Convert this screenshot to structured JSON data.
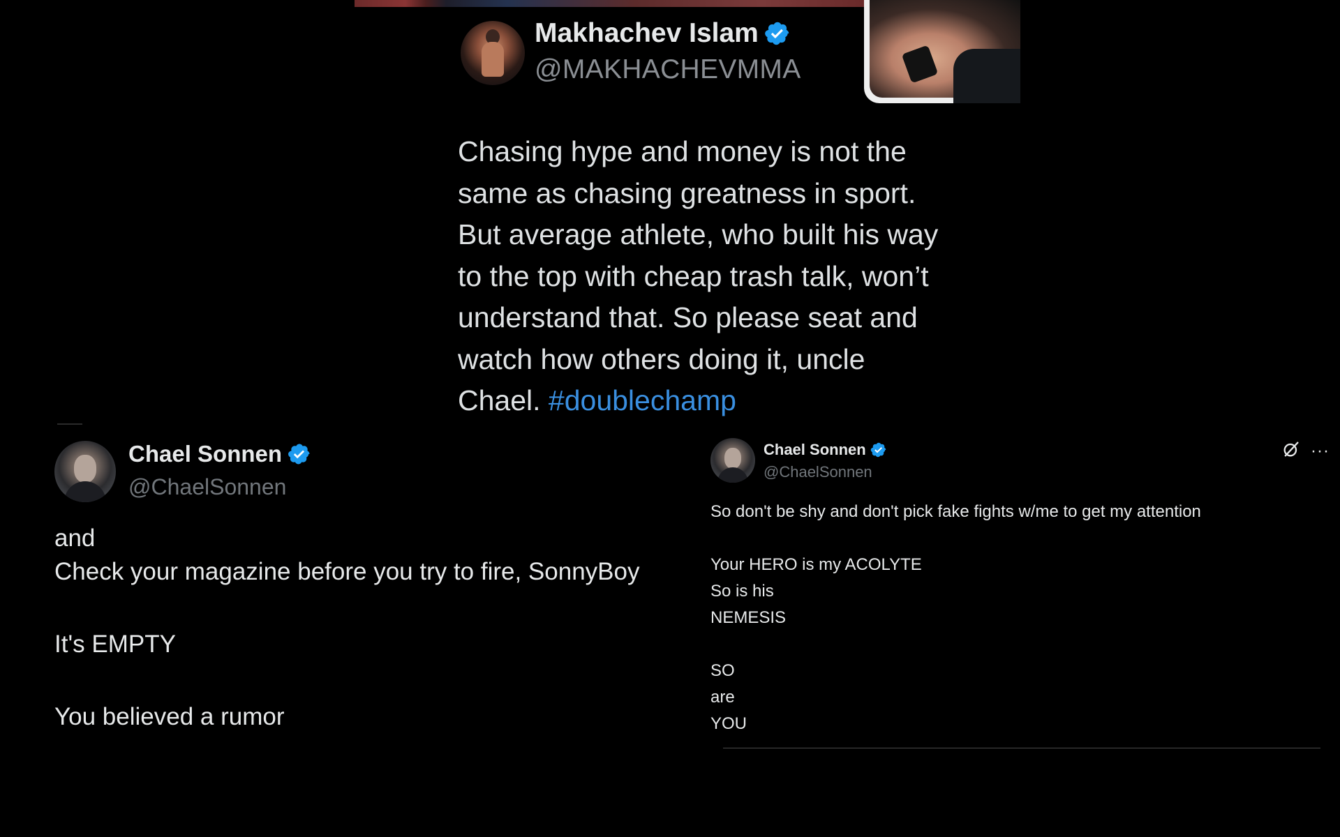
{
  "makhachev_tweet": {
    "display_name": "Makhachev Islam",
    "handle": "@MAKHACHEVMMA",
    "verified": true,
    "text_lines": [
      "Chasing hype and money is not the",
      "same as chasing greatness in sport.",
      "But average athlete, who built his way",
      "to the top with cheap trash talk, won’t",
      "understand that. So please seat and",
      "watch how others doing it, uncle"
    ],
    "last_line_prefix": "Chael. ",
    "hashtag": "#doublechamp"
  },
  "sonnen_tweet_left": {
    "display_name": "Chael Sonnen",
    "handle": "@ChaelSonnen",
    "verified": true,
    "lines": [
      "and",
      "Check your magazine before you try to fire, SonnyBoy",
      "",
      "It's EMPTY",
      "",
      "You believed a rumor"
    ]
  },
  "sonnen_tweet_right": {
    "display_name": "Chael Sonnen",
    "handle": "@ChaelSonnen",
    "verified": true,
    "lines": [
      "So don't be shy and don't pick fake fights w/me to get my attention",
      "",
      "Your HERO is my ACOLYTE",
      "So is his",
      "NEMESIS",
      "",
      "SO",
      "are",
      "YOU"
    ],
    "more_label": "···"
  },
  "colors": {
    "background": "#000000",
    "text": "#e7e9ea",
    "muted": "#71767b",
    "verified_blue": "#1d9bf0",
    "hashtag_blue": "#3a8fe0"
  },
  "icons": {
    "verified": "verified-badge-icon",
    "grok": "grok-icon",
    "more": "more-options-icon"
  }
}
